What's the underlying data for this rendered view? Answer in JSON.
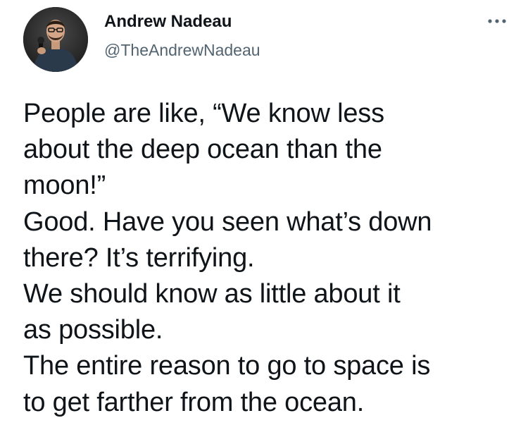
{
  "tweet": {
    "author": {
      "display_name": "Andrew Nadeau",
      "handle": "@TheAndrewNadeau",
      "avatar_icon": "avatar-photo"
    },
    "more_icon": "more-options-icon",
    "text_lines": [
      "People are like, “We know less",
      "about the deep ocean than the",
      "moon!”",
      "Good. Have you seen what’s down",
      "there? It’s terrifying.",
      "We should know as little about it",
      "as possible.",
      "The entire reason to go to space is",
      "to get farther from the ocean."
    ]
  },
  "colors": {
    "text": "#0f1419",
    "secondary_text": "#536471",
    "background": "#ffffff"
  }
}
